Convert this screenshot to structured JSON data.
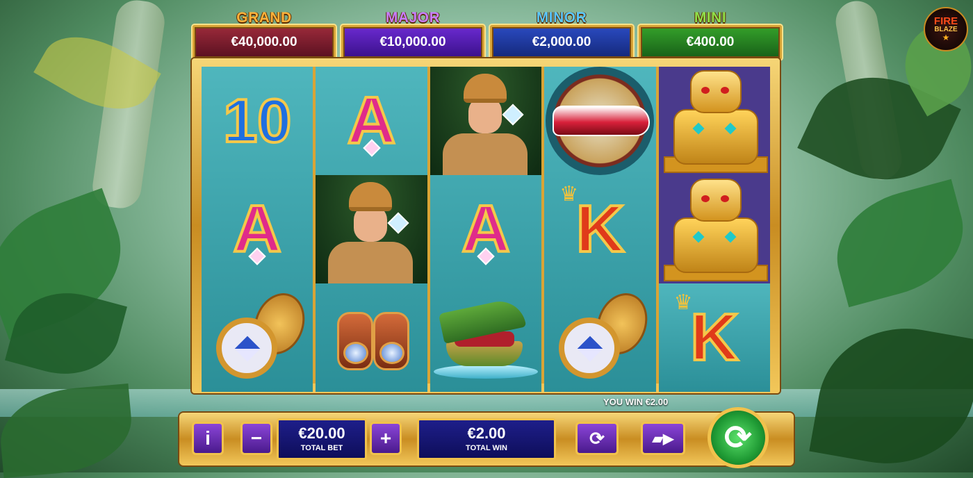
{
  "brand": {
    "line1": "FIRE",
    "line2": "BLAZE"
  },
  "jackpots": [
    {
      "name": "GRAND",
      "value": "€40,000.00",
      "title_color": "#ffb23a",
      "box_color": "#7a1e2e"
    },
    {
      "name": "MAJOR",
      "value": "€10,000.00",
      "title_color": "#c77cff",
      "box_color": "#4a1a9a"
    },
    {
      "name": "MINOR",
      "value": "€2,000.00",
      "title_color": "#59c7ff",
      "box_color": "#1f3f9a"
    },
    {
      "name": "MINI",
      "value": "€400.00",
      "title_color": "#8fe04a",
      "box_color": "#2a7a22"
    }
  ],
  "reels": [
    [
      "10",
      "A",
      "compass"
    ],
    [
      "A",
      "explorer",
      "binoculars"
    ],
    [
      "explorer",
      "A",
      "crocodile"
    ],
    [
      "compass-rose",
      "K",
      "compass"
    ],
    [
      "idol",
      "idol",
      "K"
    ]
  ],
  "win_message": "YOU WIN €2.00",
  "controls": {
    "info_label": "i",
    "minus_label": "−",
    "plus_label": "+",
    "total_bet": {
      "value": "€20.00",
      "label": "TOTAL BET"
    },
    "total_win": {
      "value": "€2.00",
      "label": "TOTAL WIN"
    },
    "autoplay_icon": "repeat-icon",
    "turbo_icon": "fast-forward-icon",
    "spin_icon": "spin-icon"
  },
  "colors": {
    "frame_gold": "#d9a436",
    "reel_bg": "#3aa3ab",
    "button_purple": "#6a2fb0",
    "spin_green": "#1f9a34"
  }
}
